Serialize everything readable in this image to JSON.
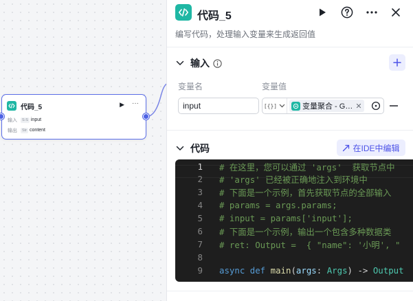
{
  "node": {
    "title": "代码_5",
    "input_label": "输入",
    "input_type": "S:S",
    "input_name": "input",
    "output_label": "输出",
    "output_type": "Str",
    "output_name": "content"
  },
  "panel": {
    "title": "代码_5",
    "description": "编写代码，处理输入变量来生成返回值",
    "input_section": {
      "title": "输入",
      "col_name": "变量名",
      "col_value": "变量值",
      "param_name": "input",
      "type_value": "[{}]",
      "ref_value": "变量聚合 - G…"
    },
    "code_section": {
      "title": "代码",
      "ide_button": "在IDE中编辑",
      "lines": [
        {
          "n": "1",
          "text": "# 在这里，您可以通过 'args'  获取节点中"
        },
        {
          "n": "2",
          "text": "# 'args' 已经被正确地注入到环境中"
        },
        {
          "n": "3",
          "text": "# 下面是一个示例，首先获取节点的全部输入"
        },
        {
          "n": "4",
          "text": "# params = args.params;"
        },
        {
          "n": "5",
          "text": "# input = params['input'];"
        },
        {
          "n": "6",
          "text": "# 下面是一个示例，输出一个包含多种数据类"
        },
        {
          "n": "7",
          "text": "# ret: Output =  { \"name\": '小明', \""
        },
        {
          "n": "8",
          "text": ""
        },
        {
          "n": "9",
          "kw": "async def ",
          "fn": "main",
          "p1": "(",
          "var": "args",
          "p2": ": ",
          "ty": "Args",
          "p3": ") -> ",
          "ret": "Output"
        }
      ]
    }
  },
  "colors": {
    "accent": "#4d53e8",
    "node_icon": "#1fb7a4",
    "editor_bg": "#1e1e1e"
  }
}
